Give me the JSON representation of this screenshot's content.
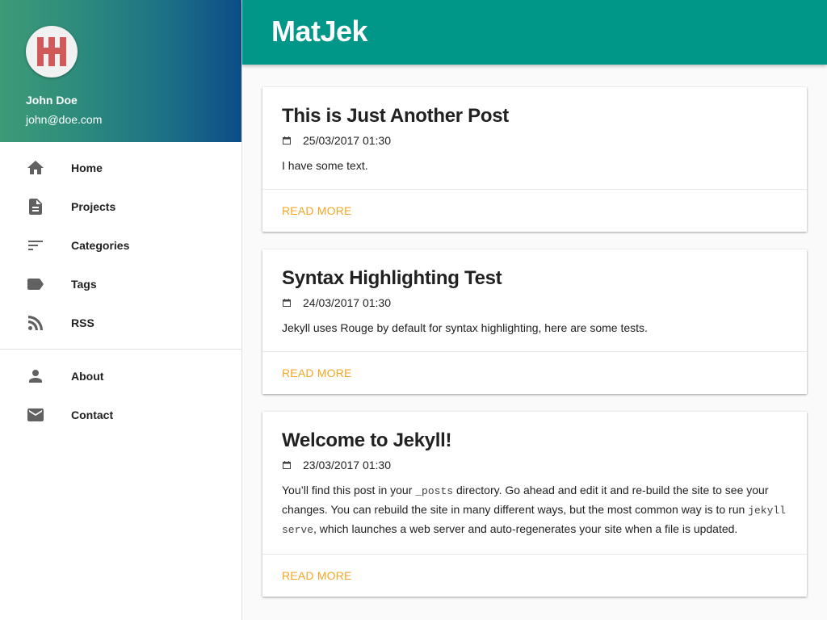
{
  "app": {
    "title": "MatJek"
  },
  "user": {
    "name": "John Doe",
    "email": "john@doe.com"
  },
  "nav": {
    "primary": [
      {
        "label": "Home",
        "icon": "home-icon"
      },
      {
        "label": "Projects",
        "icon": "file-icon"
      },
      {
        "label": "Categories",
        "icon": "sort-icon"
      },
      {
        "label": "Tags",
        "icon": "tag-icon"
      },
      {
        "label": "RSS",
        "icon": "rss-icon"
      }
    ],
    "secondary": [
      {
        "label": "About",
        "icon": "person-icon"
      },
      {
        "label": "Contact",
        "icon": "mail-icon"
      }
    ]
  },
  "posts": [
    {
      "title": "This is Just Another Post",
      "date": "25/03/2017 01:30",
      "excerpt": "I have some text.",
      "action": "Read more"
    },
    {
      "title": "Syntax Highlighting Test",
      "date": "24/03/2017 01:30",
      "excerpt": "Jekyll uses Rouge by default for syntax highlighting, here are some tests.",
      "action": "Read more"
    },
    {
      "title": "Welcome to Jekyll!",
      "date": "23/03/2017 01:30",
      "excerpt_parts": {
        "p1": "You’ll find this post in your ",
        "code1": "_posts",
        "p2": " directory. Go ahead and edit it and re-build the site to see your changes. You can rebuild the site in many different ways, but the most common way is to run ",
        "code2": "jekyll serve",
        "p3": ", which launches a web server and auto-regenerates your site when a file is updated."
      },
      "action": "Read more"
    }
  ],
  "colors": {
    "appbar": "#009688",
    "accent": "#f5a623",
    "avatar_mark": "#d05a5a"
  }
}
